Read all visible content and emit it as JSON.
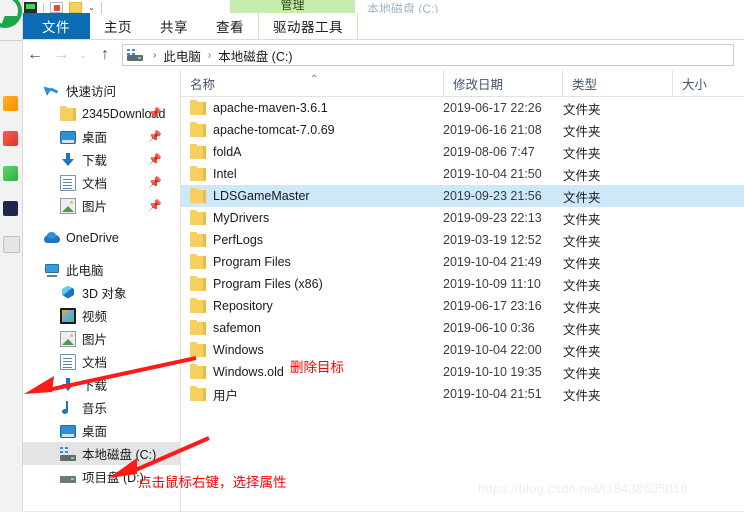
{
  "window": {
    "title": "本地磁盘 (C:)",
    "contextual_tab": "管理"
  },
  "ribbon": {
    "tabs": [
      {
        "label": "文件",
        "type": "file"
      },
      {
        "label": "主页",
        "type": "normal"
      },
      {
        "label": "共享",
        "type": "normal"
      },
      {
        "label": "查看",
        "type": "normal"
      },
      {
        "label": "驱动器工具",
        "type": "contextual"
      }
    ]
  },
  "navbar": {
    "back_icon": "back-arrow-icon",
    "forward_icon": "forward-arrow-icon",
    "recent_icon": "chevron-down-icon",
    "up_icon": "up-arrow-icon",
    "drive_icon": "drive-icon",
    "breadcrumbs": [
      "此电脑",
      "本地磁盘 (C:)"
    ],
    "separator": "›"
  },
  "nav_pane": {
    "groups": [
      {
        "header": {
          "label": "快速访问",
          "icon": "star-pin-icon"
        },
        "items": [
          {
            "label": "2345Download",
            "icon": "folder-icon",
            "pinned": true
          },
          {
            "label": "桌面",
            "icon": "desktop-icon",
            "pinned": true
          },
          {
            "label": "下载",
            "icon": "download-icon",
            "pinned": true
          },
          {
            "label": "文档",
            "icon": "documents-icon",
            "pinned": true
          },
          {
            "label": "图片",
            "icon": "pictures-icon",
            "pinned": true
          }
        ]
      },
      {
        "header": {
          "label": "OneDrive",
          "icon": "onedrive-icon"
        },
        "items": []
      },
      {
        "header": {
          "label": "此电脑",
          "icon": "this-pc-icon"
        },
        "items": [
          {
            "label": "3D 对象",
            "icon": "3d-objects-icon",
            "pinned": false
          },
          {
            "label": "视频",
            "icon": "videos-icon",
            "pinned": false
          },
          {
            "label": "图片",
            "icon": "pictures-icon",
            "pinned": false
          },
          {
            "label": "文档",
            "icon": "documents-icon",
            "pinned": false
          },
          {
            "label": "下载",
            "icon": "download-icon",
            "pinned": false
          },
          {
            "label": "音乐",
            "icon": "music-icon",
            "pinned": false
          },
          {
            "label": "桌面",
            "icon": "desktop-icon",
            "pinned": false
          },
          {
            "label": "本地磁盘 (C:)",
            "icon": "local-disk-icon",
            "pinned": false,
            "selected": true
          },
          {
            "label": "项目盘 (D:)",
            "icon": "disk-icon",
            "pinned": false
          }
        ]
      }
    ],
    "pin_icon": "pin-icon"
  },
  "columns": {
    "name": "名称",
    "date": "修改日期",
    "type": "类型",
    "size": "大小",
    "sort_indicator": "sort-ascending-caret"
  },
  "files": [
    {
      "name": "apache-maven-3.6.1",
      "date": "2019-06-17 22:26",
      "type": "文件夹",
      "size": "",
      "selected": false
    },
    {
      "name": "apache-tomcat-7.0.69",
      "date": "2019-06-16 21:08",
      "type": "文件夹",
      "size": "",
      "selected": false
    },
    {
      "name": "foldA",
      "date": "2019-08-06 7:47",
      "type": "文件夹",
      "size": "",
      "selected": false
    },
    {
      "name": "Intel",
      "date": "2019-10-04 21:50",
      "type": "文件夹",
      "size": "",
      "selected": false
    },
    {
      "name": "LDSGameMaster",
      "date": "2019-09-23 21:56",
      "type": "文件夹",
      "size": "",
      "selected": true
    },
    {
      "name": "MyDrivers",
      "date": "2019-09-23 22:13",
      "type": "文件夹",
      "size": "",
      "selected": false
    },
    {
      "name": "PerfLogs",
      "date": "2019-03-19 12:52",
      "type": "文件夹",
      "size": "",
      "selected": false
    },
    {
      "name": "Program Files",
      "date": "2019-10-04 21:49",
      "type": "文件夹",
      "size": "",
      "selected": false
    },
    {
      "name": "Program Files (x86)",
      "date": "2019-10-09 11:10",
      "type": "文件夹",
      "size": "",
      "selected": false
    },
    {
      "name": "Repository",
      "date": "2019-06-17 23:16",
      "type": "文件夹",
      "size": "",
      "selected": false
    },
    {
      "name": "safemon",
      "date": "2019-06-10 0:36",
      "type": "文件夹",
      "size": "",
      "selected": false
    },
    {
      "name": "Windows",
      "date": "2019-10-04 22:00",
      "type": "文件夹",
      "size": "",
      "selected": false
    },
    {
      "name": "Windows.old",
      "date": "2019-10-10 19:35",
      "type": "文件夹",
      "size": "",
      "selected": false
    },
    {
      "name": "用户",
      "date": "2019-10-04 21:51",
      "type": "文件夹",
      "size": "",
      "selected": false
    }
  ],
  "annotations": {
    "delete_target": "删除目标",
    "right_click_hint": "点击鼠标右键，选择属性",
    "arrow_color": "#ff0000"
  },
  "watermark": "https://blog.csdn.net/t18438605018",
  "colors": {
    "file_tab_blue": "#0b6cb5",
    "contextual_green": "#c8ebae",
    "selection_blue": "#cce8f9",
    "nav_selection_gray": "#e4e4e4",
    "folder_yellow": "#f6cf5f",
    "annotation_red": "#ff0000"
  }
}
